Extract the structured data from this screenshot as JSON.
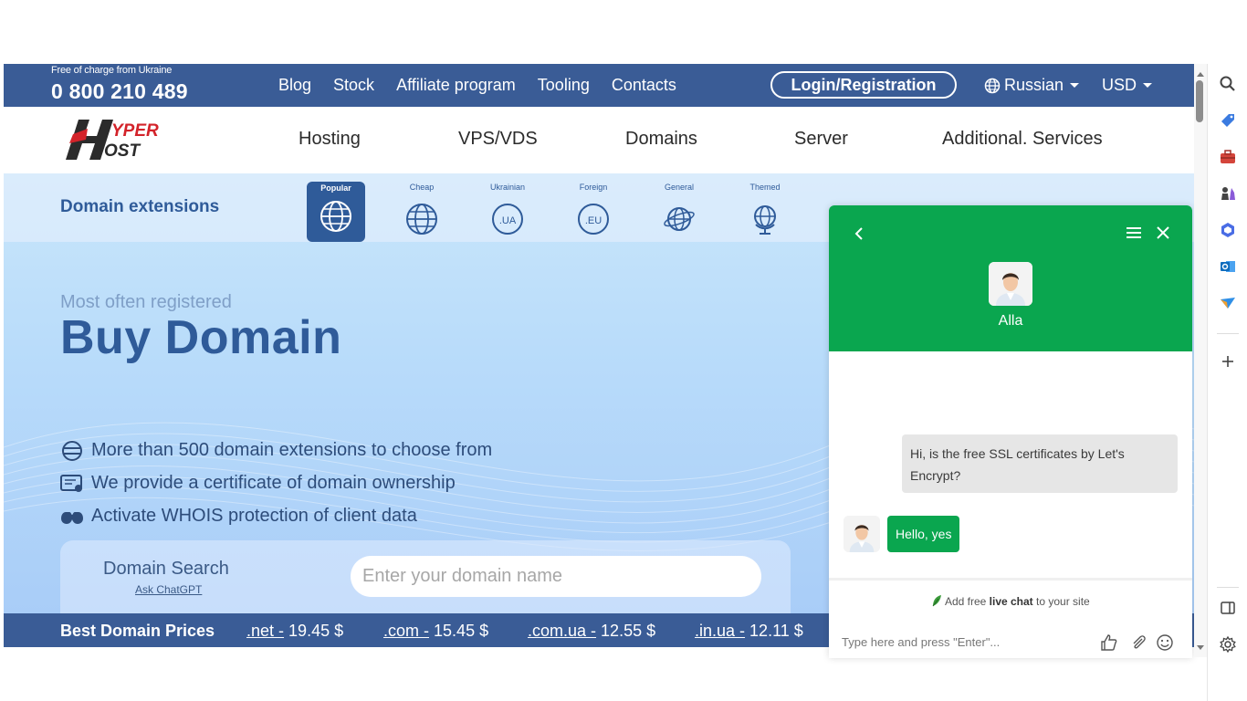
{
  "topbar": {
    "free_label": "Free of charge from Ukraine",
    "phone": "0 800 210 489",
    "links": [
      "Blog",
      "Stock",
      "Affiliate program",
      "Tooling",
      "Contacts"
    ],
    "login": "Login/Registration",
    "language": "Russian",
    "currency": "USD"
  },
  "logo": {
    "text_top": "YPER",
    "text_bottom": "OST",
    "letter": "H"
  },
  "mainnav": [
    "Hosting",
    "VPS/VDS",
    "Domains",
    "Server",
    "Additional. Services"
  ],
  "extensions": {
    "title": "Domain extensions",
    "tabs": [
      {
        "label": "Popular",
        "icon": "globe-icon",
        "active": true
      },
      {
        "label": "Cheap",
        "icon": "globe-icon"
      },
      {
        "label": "Ukrainian",
        "icon_text": ".UA"
      },
      {
        "label": "Foreign",
        "icon_text": ".EU"
      },
      {
        "label": "General",
        "icon": "globe-orbit-icon"
      },
      {
        "label": "Themed",
        "icon": "desk-globe-icon"
      }
    ]
  },
  "hero": {
    "subtitle": "Most often registered",
    "title": "Buy Domain",
    "features": [
      {
        "icon": "database-icon",
        "text": "More than 500 domain extensions to choose from"
      },
      {
        "icon": "certificate-icon",
        "text": "We provide a certificate of domain ownership"
      },
      {
        "icon": "glasses-icon",
        "text": "Activate WHOIS protection of client data"
      }
    ]
  },
  "search": {
    "label": "Domain Search",
    "ask": "Ask ChatGPT",
    "placeholder": "Enter your domain name"
  },
  "prices": {
    "title": "Best Domain Prices",
    "items": [
      {
        "tld": ".net -",
        "price": "19.45 $"
      },
      {
        "tld": ".com -",
        "price": "15.45 $"
      },
      {
        "tld": ".com.ua -",
        "price": "12.55 $"
      },
      {
        "tld": ".in.ua -",
        "price": "12.11 $"
      }
    ]
  },
  "chat": {
    "agent": "Alla",
    "messages": [
      {
        "from": "user",
        "text": "Hi, is the free SSL certificates by Let's Encrypt?"
      },
      {
        "from": "agent",
        "text": "Hello, yes"
      }
    ],
    "powered_pre": "Add free ",
    "powered_bold": "live chat",
    "powered_post": " to your site",
    "input_placeholder": "Type here and press \"Enter\"...",
    "accent": "#0aa64f"
  },
  "colors": {
    "brand": "#3a5c96",
    "logo_red": "#d3232a"
  },
  "sidebar_icons": [
    "search-icon",
    "tag-icon",
    "toolbox-icon",
    "chess-icon",
    "copilot-icon",
    "outlook-icon",
    "send-icon",
    "add-icon",
    "split-view-icon",
    "settings-icon"
  ]
}
